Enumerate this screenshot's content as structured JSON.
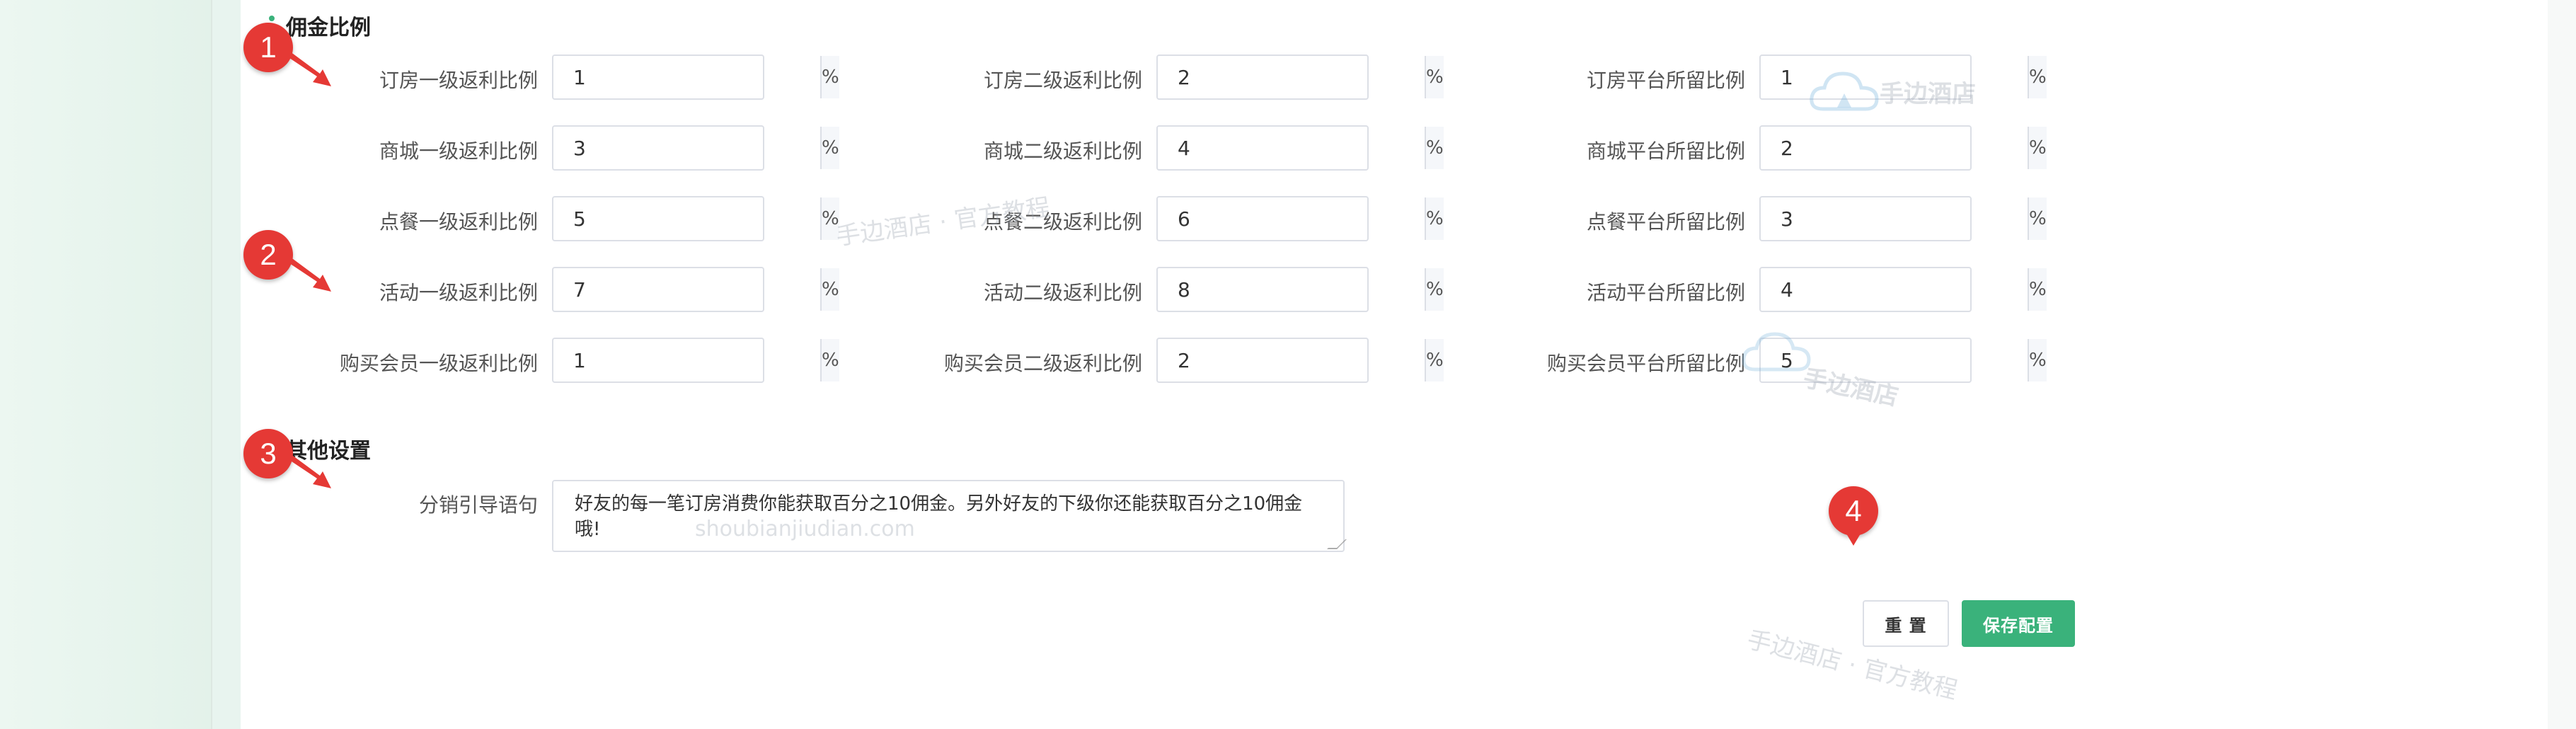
{
  "sections": {
    "commission": "佣金比例",
    "other": "其他设置"
  },
  "unit": "%",
  "rows": [
    {
      "c1": {
        "label": "订房一级返利比例",
        "value": "1"
      },
      "c2": {
        "label": "订房二级返利比例",
        "value": "2"
      },
      "c3": {
        "label": "订房平台所留比例",
        "value": "1"
      }
    },
    {
      "c1": {
        "label": "商城一级返利比例",
        "value": "3"
      },
      "c2": {
        "label": "商城二级返利比例",
        "value": "4"
      },
      "c3": {
        "label": "商城平台所留比例",
        "value": "2"
      }
    },
    {
      "c1": {
        "label": "点餐一级返利比例",
        "value": "5"
      },
      "c2": {
        "label": "点餐二级返利比例",
        "value": "6"
      },
      "c3": {
        "label": "点餐平台所留比例",
        "value": "3"
      }
    },
    {
      "c1": {
        "label": "活动一级返利比例",
        "value": "7"
      },
      "c2": {
        "label": "活动二级返利比例",
        "value": "8"
      },
      "c3": {
        "label": "活动平台所留比例",
        "value": "4"
      }
    },
    {
      "c1": {
        "label": "购买会员一级返利比例",
        "value": "1"
      },
      "c2": {
        "label": "购买会员二级返利比例",
        "value": "2"
      },
      "c3": {
        "label": "购买会员平台所留比例",
        "value": "5"
      }
    }
  ],
  "guide": {
    "label": "分销引导语句",
    "value": "好友的每一笔订房消费你能获取百分之10佣金。另外好友的下级你还能获取百分之10佣金哦!"
  },
  "buttons": {
    "reset": "重 置",
    "save": "保存配置"
  },
  "badges": [
    "1",
    "2",
    "3",
    "4"
  ],
  "watermarks": {
    "brand": "手边酒店",
    "tutorial": "手边酒店 · 官方教程",
    "domain": "shoubianjiudian.com"
  },
  "colors": {
    "accent": "#3ab27b",
    "badge": "#e53935"
  }
}
